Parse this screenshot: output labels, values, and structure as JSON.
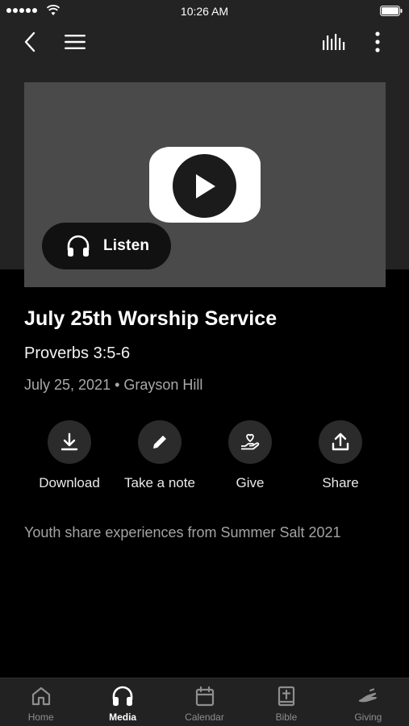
{
  "status_bar": {
    "time": "10:26 AM"
  },
  "nav": {
    "back_icon": "chevron-left-icon",
    "menu_icon": "hamburger-menu-icon",
    "audio_icon": "audio-bars-icon",
    "more_icon": "more-vertical-icon"
  },
  "media": {
    "listen_label": "Listen",
    "title": "July 25th Worship Service",
    "subtitle": "Proverbs 3:5-6",
    "meta": "July 25, 2021 • Grayson Hill",
    "description": "Youth share experiences from Summer Salt 2021"
  },
  "actions": [
    {
      "label": "Download",
      "icon": "download-icon"
    },
    {
      "label": "Take a note",
      "icon": "pencil-icon"
    },
    {
      "label": "Give",
      "icon": "hand-heart-icon"
    },
    {
      "label": "Share",
      "icon": "share-icon"
    }
  ],
  "tabs": [
    {
      "label": "Home",
      "icon": "home-icon",
      "active": false
    },
    {
      "label": "Media",
      "icon": "headphones-icon",
      "active": true
    },
    {
      "label": "Calendar",
      "icon": "calendar-icon",
      "active": false
    },
    {
      "label": "Bible",
      "icon": "bible-icon",
      "active": false
    },
    {
      "label": "Giving",
      "icon": "giving-hand-icon",
      "active": false
    }
  ],
  "colors": {
    "background": "#000000",
    "header_background": "#232323",
    "card_background": "#4a4a4a",
    "tab_bar_background": "#222222",
    "muted_text": "#a9a9a9"
  }
}
